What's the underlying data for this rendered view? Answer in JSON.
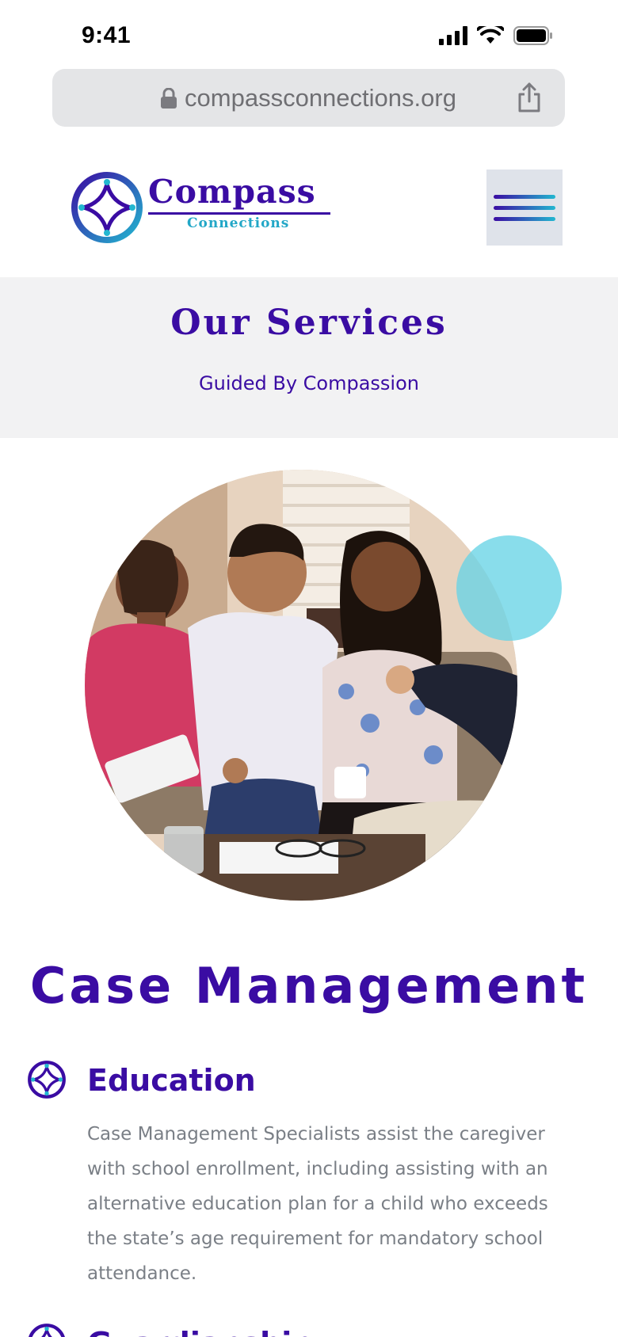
{
  "status_bar": {
    "time": "9:41"
  },
  "browser": {
    "url": "compassconnections.org",
    "icons": [
      "lock-icon",
      "share-icon"
    ]
  },
  "header": {
    "logo_word": "Compass",
    "logo_sub": "Connections",
    "menu_icon": "hamburger-menu-icon"
  },
  "services_band": {
    "title": "Our Services",
    "subtitle": "Guided By Compassion"
  },
  "hero": {
    "image": "family-with-counselor-photo",
    "accent_color": "#68d4e6"
  },
  "section": {
    "heading": "Case Management",
    "items": [
      {
        "title": "Education",
        "body": "Case Management Specialists assist the caregiver with school enrollment, including assisting with an alternative education plan for a child who exceeds the state’s age requirement for mandatory school attendance."
      },
      {
        "title": "Guardianship"
      }
    ]
  },
  "colors": {
    "brand_purple": "#3a0ca3",
    "brand_teal": "#22a7c7",
    "band_gray": "#f2f2f3",
    "body_gray": "#7a7f86"
  }
}
